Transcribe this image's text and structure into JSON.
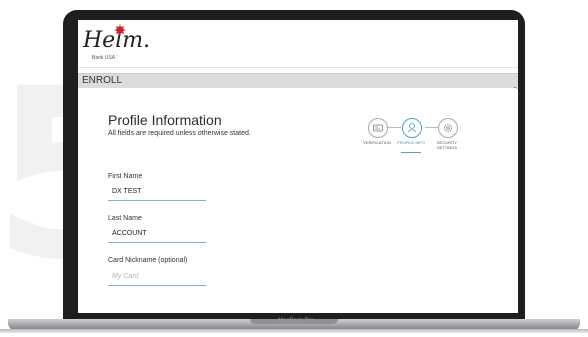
{
  "background": {
    "numeral": "5"
  },
  "device": {
    "model_label": "MacBook Pro"
  },
  "app": {
    "logo": {
      "name": "Helm.",
      "tagline": "Bank USA"
    },
    "section_title": "ENROLL",
    "page_title": "Profile Information",
    "page_subtitle": "All fields are required unless otherwise stated.",
    "steps": [
      {
        "label": "VERIFICATION",
        "icon": "id-card-icon",
        "active": false
      },
      {
        "label": "PROFILE INFO",
        "icon": "person-icon",
        "active": true
      },
      {
        "label": "SECURITY SETTINGS",
        "icon": "gear-icon",
        "active": false
      }
    ],
    "fields": [
      {
        "label": "First Name",
        "value": "DX TEST",
        "placeholder": ""
      },
      {
        "label": "Last Name",
        "value": "ACCOUNT",
        "placeholder": ""
      },
      {
        "label": "Card Nickname (optional)",
        "value": "",
        "placeholder": "My Card"
      }
    ],
    "colors": {
      "accent": "#4aa3c8",
      "logo_mark": "#c8202f",
      "enroll_bar": "#dcdcdc"
    }
  }
}
